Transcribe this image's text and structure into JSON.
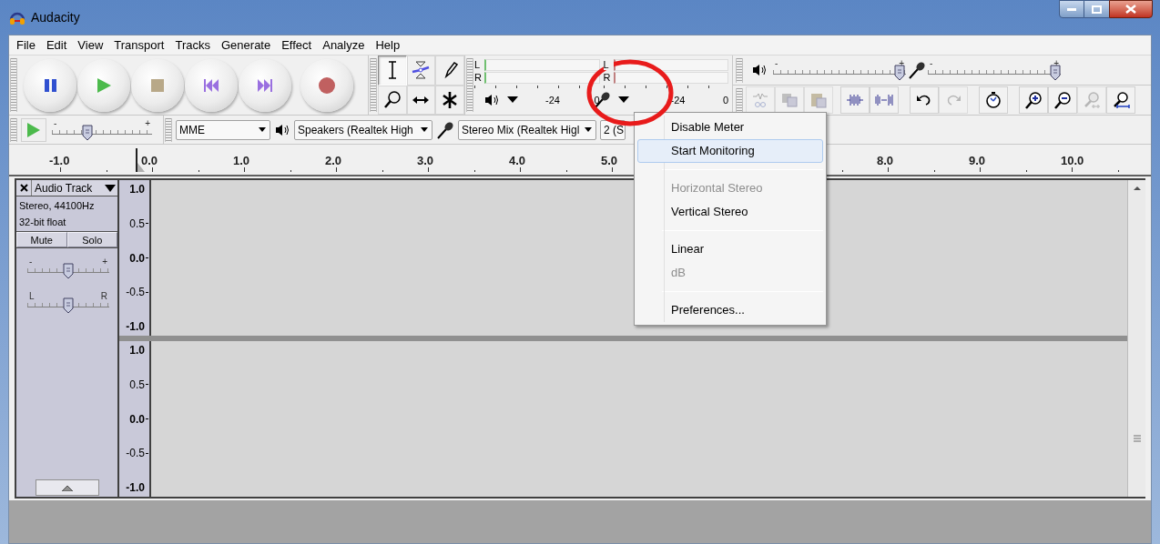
{
  "window": {
    "title": "Audacity"
  },
  "menu_bar": [
    "File",
    "Edit",
    "View",
    "Transport",
    "Tracks",
    "Generate",
    "Effect",
    "Analyze",
    "Help"
  ],
  "tools": [
    {
      "kind": "selection",
      "selected": true
    },
    {
      "kind": "envelope",
      "selected": false
    },
    {
      "kind": "draw",
      "selected": false
    },
    {
      "kind": "zoom",
      "selected": false
    },
    {
      "kind": "timeshift",
      "selected": false
    },
    {
      "kind": "multi",
      "selected": false
    }
  ],
  "meters": [
    {
      "kind": "playback",
      "channels": [
        "L",
        "R"
      ],
      "scale": [
        "-24",
        "0"
      ]
    },
    {
      "kind": "recording",
      "channels": [
        "L",
        "R"
      ],
      "scale": [
        "-24",
        "0"
      ]
    }
  ],
  "mixer": [
    {
      "kind": "playback",
      "labels": [
        "-",
        "+"
      ],
      "level": 0.95
    },
    {
      "kind": "recording",
      "labels": [
        "-",
        "+"
      ],
      "level": 0.96
    }
  ],
  "edit_tools": [
    {
      "kind": "cut",
      "disabled": true
    },
    {
      "kind": "copy",
      "disabled": true
    },
    {
      "kind": "paste",
      "disabled": true
    },
    {
      "kind": "trim",
      "disabled": false
    },
    {
      "kind": "silence",
      "disabled": false
    },
    {
      "kind": "undo",
      "disabled": false
    },
    {
      "kind": "redo",
      "disabled": true
    },
    {
      "kind": "sync",
      "disabled": false
    },
    {
      "kind": "zoom_in",
      "disabled": false
    },
    {
      "kind": "zoom_out",
      "disabled": false
    },
    {
      "kind": "fit_selection",
      "disabled": true
    },
    {
      "kind": "fit_project",
      "disabled": false
    }
  ],
  "play_at_speed": {
    "labels": [
      "-",
      "+"
    ],
    "level": 0.35
  },
  "device": {
    "host": "MME",
    "output": "Speakers (Realtek High",
    "input": "Stereo Mix (Realtek Higl",
    "channels": "2 (S"
  },
  "ruler": [
    "-1.0",
    "0.0",
    "1.0",
    "2.0",
    "3.0",
    "4.0",
    "5.0",
    "8.0",
    "9.0",
    "10.0"
  ],
  "track": {
    "name": "Audio Track",
    "info": [
      "Stereo, 44100Hz",
      "32-bit float"
    ],
    "buttons": [
      "Mute",
      "Solo"
    ],
    "gain": {
      "labels": [
        "-",
        "+"
      ],
      "level": 0.5
    },
    "pan": {
      "labels": [
        "L",
        "R"
      ],
      "level": 0.5
    },
    "channels": [
      {
        "scale": [
          "1.0",
          "0.5",
          "0.0",
          "-0.5",
          "-1.0"
        ]
      },
      {
        "scale": [
          "1.0",
          "0.5",
          "0.0",
          "-0.5",
          "-1.0"
        ]
      }
    ]
  },
  "meter_menu": {
    "items": [
      {
        "kind": "item",
        "label": "Disable Meter",
        "disabled": false,
        "selected": false
      },
      {
        "kind": "item",
        "label": "Start Monitoring",
        "disabled": false,
        "selected": true
      },
      {
        "kind": "separator"
      },
      {
        "kind": "item",
        "label": "Horizontal Stereo",
        "disabled": true,
        "selected": false
      },
      {
        "kind": "item",
        "label": "Vertical Stereo",
        "disabled": false,
        "selected": false
      },
      {
        "kind": "separator"
      },
      {
        "kind": "item",
        "label": "Linear",
        "disabled": false,
        "selected": false
      },
      {
        "kind": "item",
        "label": "dB",
        "disabled": true,
        "selected": false
      },
      {
        "kind": "separator"
      },
      {
        "kind": "item",
        "label": "Preferences...",
        "disabled": false,
        "selected": false
      }
    ]
  }
}
